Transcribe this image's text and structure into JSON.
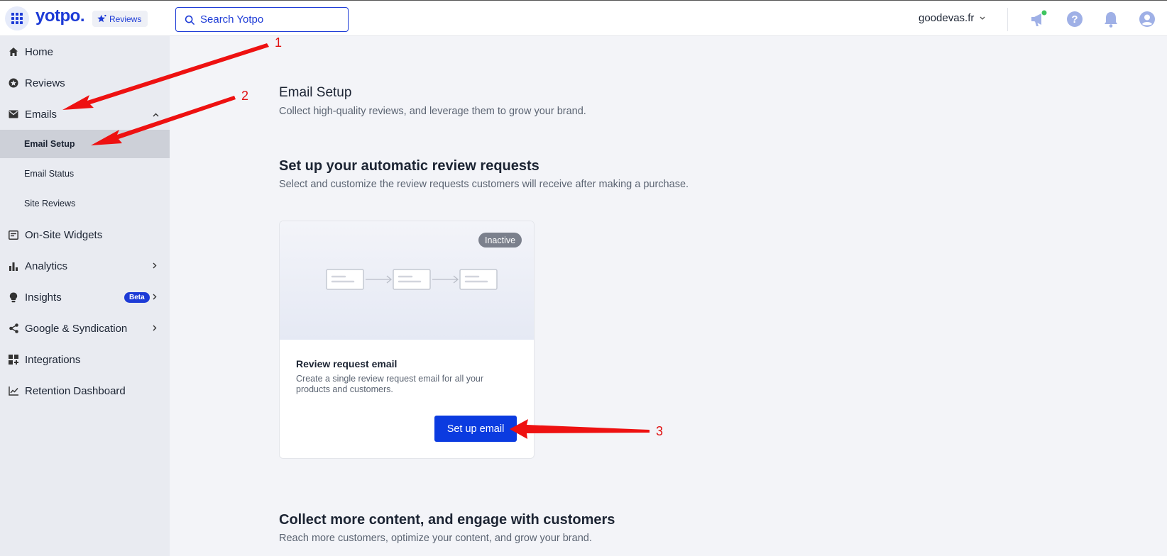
{
  "topbar": {
    "logo_text": "yotpo.",
    "product_label": "Reviews",
    "search_placeholder": "Search Yotpo",
    "store_name": "goodevas.fr",
    "icons": [
      "apps-grid-icon",
      "megaphone-icon",
      "help-icon",
      "bell-icon",
      "user-account-icon"
    ],
    "notification_dot_color": "#3ec45f"
  },
  "sidebar": {
    "items": [
      {
        "label": "Home",
        "icon": "home-icon"
      },
      {
        "label": "Reviews",
        "icon": "star-circle-icon"
      },
      {
        "label": "Emails",
        "icon": "mail-icon",
        "expanded": true
      },
      {
        "label": "On-Site Widgets",
        "icon": "widget-icon"
      },
      {
        "label": "Analytics",
        "icon": "bar-chart-icon"
      },
      {
        "label": "Insights",
        "icon": "lightbulb-icon",
        "badge": "Beta"
      },
      {
        "label": "Google & Syndication",
        "icon": "share-icon"
      },
      {
        "label": "Integrations",
        "icon": "grid-plus-icon"
      },
      {
        "label": "Retention Dashboard",
        "icon": "line-chart-icon"
      }
    ],
    "email_subitems": [
      {
        "label": "Email Setup",
        "active": true
      },
      {
        "label": "Email Status",
        "active": false
      },
      {
        "label": "Site Reviews",
        "active": false
      }
    ]
  },
  "main": {
    "page_title": "Email Setup",
    "page_subtitle": "Collect high-quality reviews, and leverage them to grow your brand.",
    "section_title": "Set up your automatic review requests",
    "section_subtitle": "Select and customize the review requests customers will receive after making a purchase.",
    "card": {
      "status": "Inactive",
      "title": "Review request email",
      "description": "Create a single review request email for all your products and customers.",
      "button_label": "Set up email"
    },
    "section2_title": "Collect more content, and engage with customers",
    "section2_subtitle": "Reach more customers, optimize your content, and grow your brand."
  },
  "annotations": {
    "numbers": [
      "1",
      "2",
      "3"
    ],
    "color": "#e01010"
  }
}
